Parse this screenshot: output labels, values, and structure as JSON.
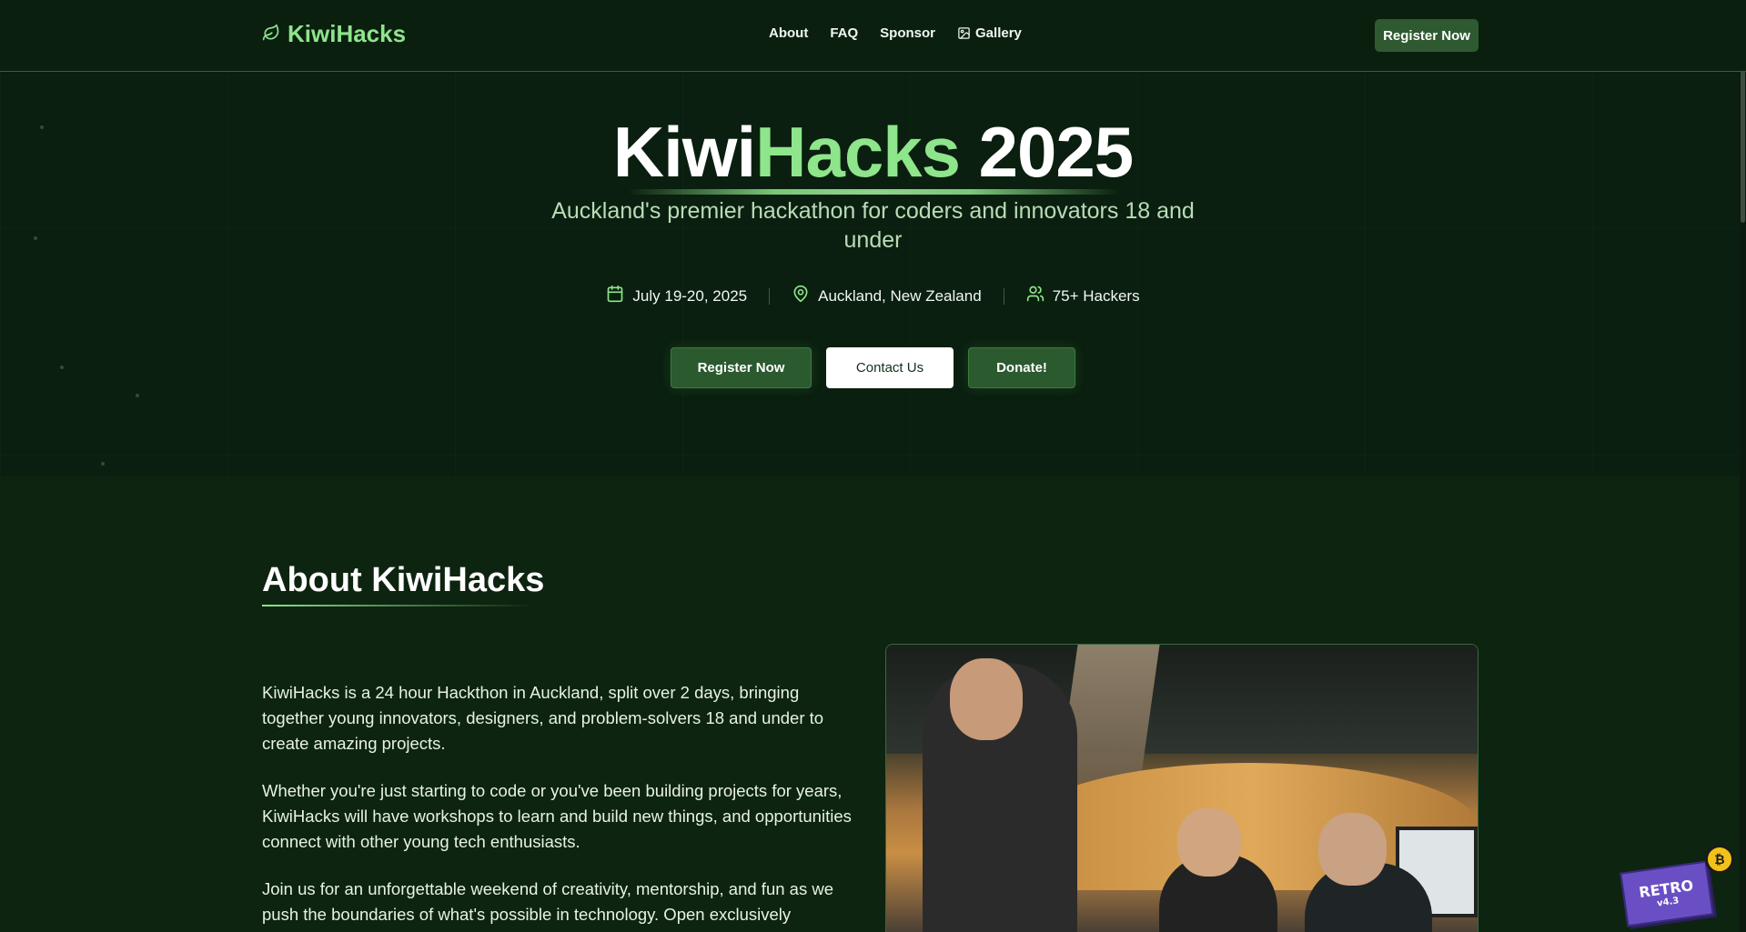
{
  "nav": {
    "logo_text": "KiwiHacks",
    "links": [
      {
        "label": "About"
      },
      {
        "label": "FAQ"
      },
      {
        "label": "Sponsor"
      },
      {
        "label": "Gallery"
      }
    ],
    "register_label": "Register Now"
  },
  "hero": {
    "title_part1": "Kiwi",
    "title_accent": "Hacks",
    "title_part2": " 2025",
    "subtitle": "Auckland's premier hackathon for coders and innovators 18 and under",
    "meta": {
      "date": "July 19-20, 2025",
      "location": "Auckland, New Zealand",
      "hackers": "75+ Hackers"
    },
    "buttons": {
      "register": "Register Now",
      "contact": "Contact Us",
      "donate": "Donate!"
    }
  },
  "about": {
    "title": "About KiwiHacks",
    "paragraphs": [
      "KiwiHacks is a 24 hour Hackthon in Auckland, split over 2 days, bringing together young innovators, designers, and problem-solvers 18 and under to create amazing projects.",
      "Whether you're just starting to code or you've been building projects for years, KiwiHacks will have workshops to learn and build new things, and opportunities connect with other young tech enthusiasts.",
      "Join us for an unforgettable weekend of creativity, mentorship, and fun as we push the boundaries of what's possible in technology. Open exclusively"
    ]
  },
  "retro_badge": {
    "label": "RETRO",
    "version": "v4.3"
  },
  "colors": {
    "background": "#0a1f0f",
    "accent": "#8ee58b",
    "button_green": "#2b5a2e",
    "retro_purple": "#6a4fc4"
  },
  "icons": {
    "logo": "leaf-icon",
    "gallery": "image-icon",
    "date": "calendar-icon",
    "location": "map-pin-icon",
    "hackers": "users-icon"
  }
}
